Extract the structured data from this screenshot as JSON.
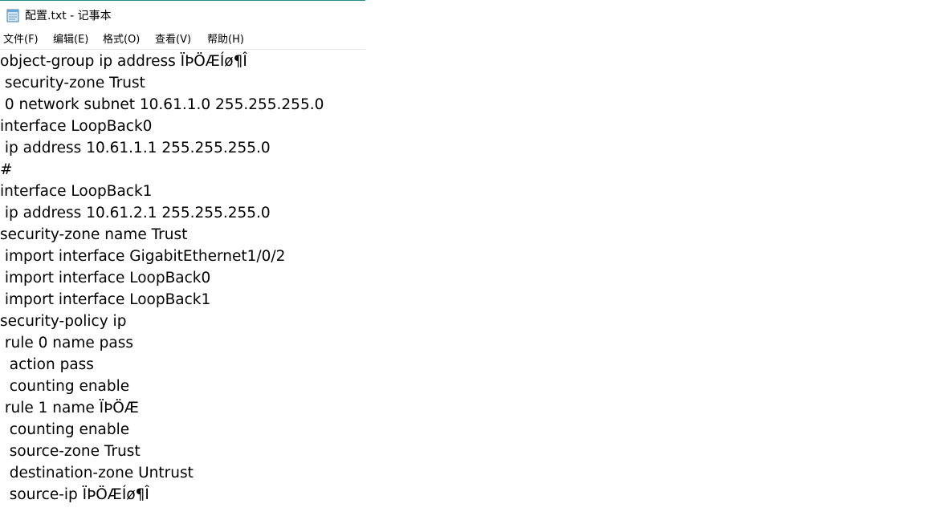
{
  "window": {
    "title": "配置.txt - 记事本",
    "icon": "notepad-icon"
  },
  "menu": [
    {
      "label": "文件(F)"
    },
    {
      "label": "编辑(E)"
    },
    {
      "label": "格式(O)"
    },
    {
      "label": "查看(V)"
    },
    {
      "label": "帮助(H)"
    }
  ],
  "content": {
    "lines": [
      "object-group ip address ÏÞÖÆÍø¶Î",
      " security-zone Trust",
      " 0 network subnet 10.61.1.0 255.255.255.0",
      "interface LoopBack0",
      " ip address 10.61.1.1 255.255.255.0",
      "#",
      "interface LoopBack1",
      " ip address 10.61.2.1 255.255.255.0",
      "security-zone name Trust",
      " import interface GigabitEthernet1/0/2",
      " import interface LoopBack0",
      " import interface LoopBack1",
      "security-policy ip",
      " rule 0 name pass",
      "  action pass",
      "  counting enable",
      " rule 1 name ÏÞÖÆ",
      "  counting enable",
      "  source-zone Trust",
      "  destination-zone Untrust",
      "  source-ip ÏÞÖÆÍø¶Î"
    ]
  }
}
